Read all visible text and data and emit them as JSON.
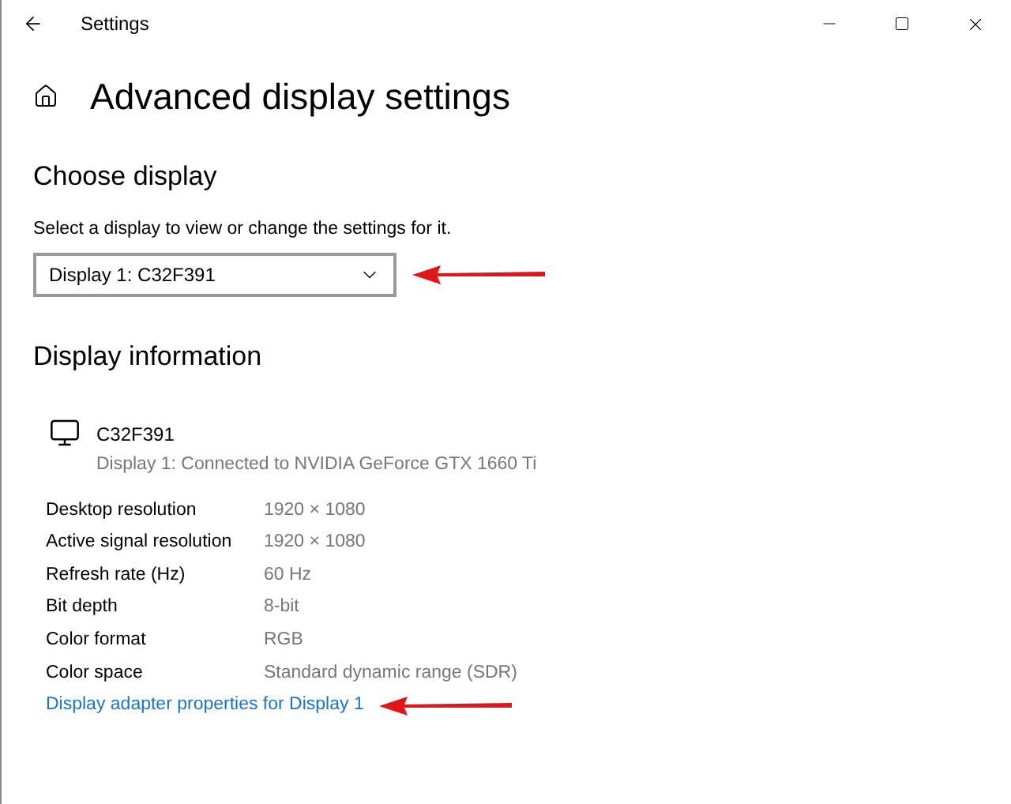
{
  "window": {
    "title": "Settings"
  },
  "page_title": "Advanced display settings",
  "choose_display": {
    "heading": "Choose display",
    "label": "Select a display to view or change the settings for it.",
    "dropdown": {
      "value": "Display 1: C32F391"
    }
  },
  "display_information": {
    "heading": "Display information",
    "monitor": {
      "name": "C32F391",
      "description": "Display 1: Connected to NVIDIA GeForce GTX 1660 Ti"
    },
    "rows": [
      {
        "label": "Desktop resolution",
        "value": "1920 × 1080"
      },
      {
        "label": "Active signal resolution",
        "value": "1920 × 1080"
      },
      {
        "label": "Refresh rate (Hz)",
        "value": "60 Hz"
      },
      {
        "label": "Bit depth",
        "value": "8-bit"
      },
      {
        "label": "Color format",
        "value": "RGB"
      },
      {
        "label": "Color space",
        "value": "Standard dynamic range (SDR)"
      }
    ],
    "link": "Display adapter properties for Display 1"
  }
}
